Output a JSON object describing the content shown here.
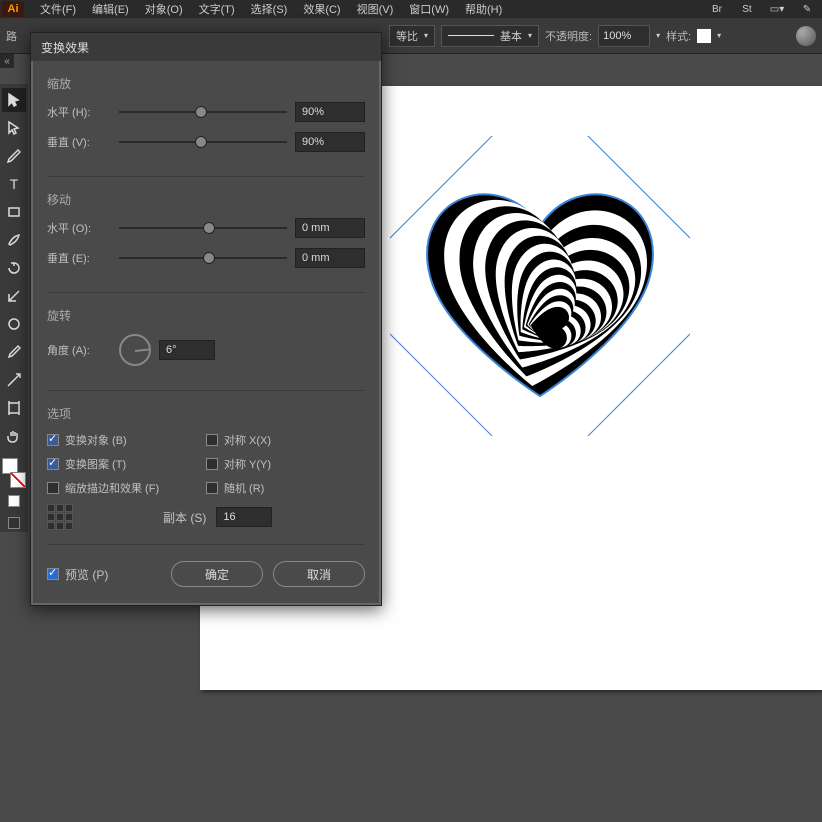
{
  "menubar": {
    "items": [
      "文件(F)",
      "编辑(E)",
      "对象(O)",
      "文字(T)",
      "选择(S)",
      "效果(C)",
      "视图(V)",
      "窗口(W)",
      "帮助(H)"
    ],
    "icons": [
      "Br",
      "St"
    ]
  },
  "controlbar": {
    "path_label": "路",
    "ratio_label": "等比",
    "stroke_label": "基本",
    "opacity_label": "不透明度:",
    "opacity_value": "100%",
    "style_label": "样式:"
  },
  "dialog": {
    "title": "变换效果",
    "scale": {
      "title": "缩放",
      "h_label": "水平 (H):",
      "h_value": "90%",
      "v_label": "垂直 (V):",
      "v_value": "90%"
    },
    "move": {
      "title": "移动",
      "h_label": "水平 (O):",
      "h_value": "0 mm",
      "v_label": "垂直 (E):",
      "v_value": "0 mm"
    },
    "rotate": {
      "title": "旋转",
      "angle_label": "角度 (A):",
      "angle_value": "6°"
    },
    "options": {
      "title": "选项",
      "transform_objects": "变换对象 (B)",
      "reflect_x": "对称 X(X)",
      "transform_patterns": "变换图案 (T)",
      "reflect_y": "对称 Y(Y)",
      "scale_strokes": "缩放描边和效果 (F)",
      "random": "随机 (R)",
      "copies_label": "副本 (S)",
      "copies_value": "16"
    },
    "preview_label": "预览 (P)",
    "ok": "确定",
    "cancel": "取消"
  },
  "tools": {
    "names": [
      "selection",
      "direct-select",
      "pen",
      "type",
      "rectangle",
      "ellipse",
      "rotate",
      "scale",
      "width",
      "eyedropper",
      "slice",
      "hand"
    ]
  }
}
